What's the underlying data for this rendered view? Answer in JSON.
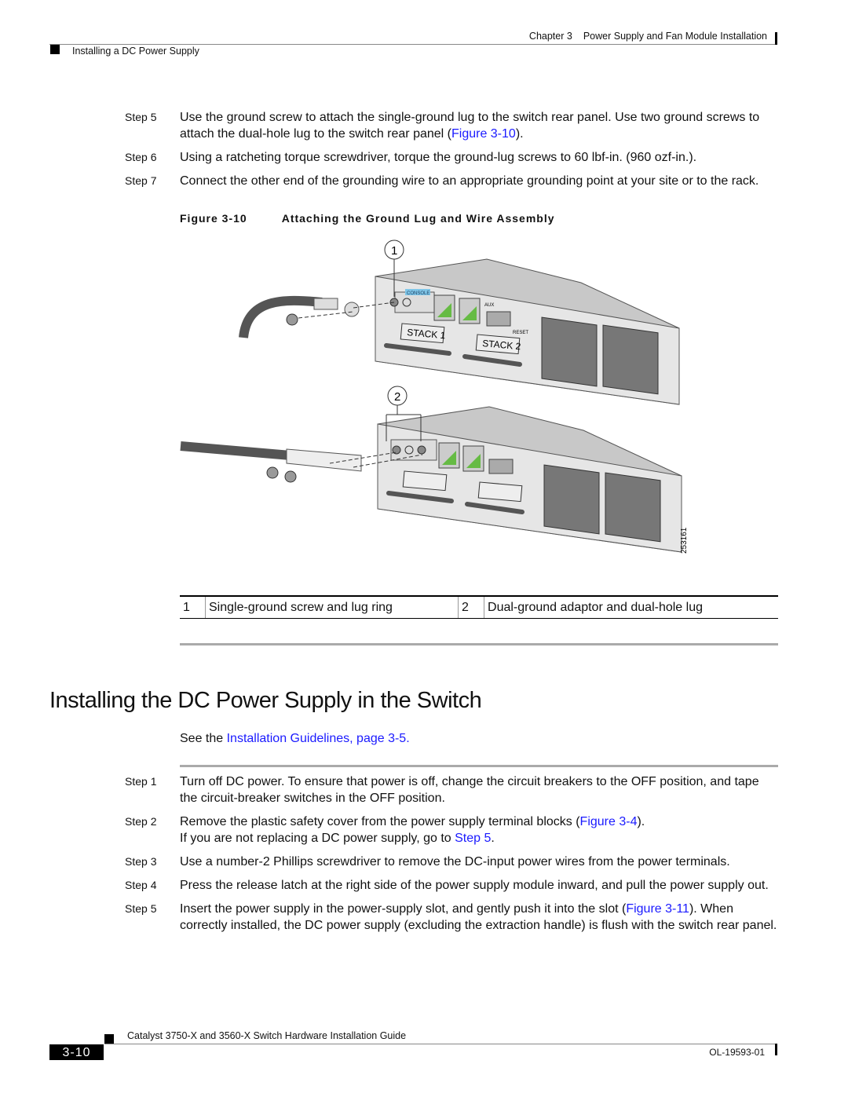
{
  "header": {
    "chapter": "Chapter 3",
    "chapter_title": "Power Supply and Fan Module Installation",
    "section": "Installing a DC Power Supply"
  },
  "steps_top": [
    {
      "label": "Step 5",
      "text_a": "Use the ground screw to attach the single-ground lug to the switch rear panel. Use two ground screws to attach the dual-hole lug to the switch rear panel (",
      "link": "Figure 3-10",
      "text_b": ")."
    },
    {
      "label": "Step 6",
      "text": "Using a ratcheting torque screwdriver, torque the ground-lug screws to 60 lbf-in. (960 ozf-in.)."
    },
    {
      "label": "Step 7",
      "text": "Connect the other end of the grounding wire to an appropriate grounding point at your site or to the rack."
    }
  ],
  "figure": {
    "number": "Figure 3-10",
    "title": "Attaching the Ground Lug and Wire Assembly",
    "callouts": [
      "1",
      "2"
    ],
    "labels": {
      "console": "CONSOLE",
      "aux": "AUX",
      "reset": "RESET",
      "stack1": "STACK 1",
      "stack2": "STACK 2"
    },
    "art_id": "253161",
    "legend": [
      {
        "num": "1",
        "text": "Single-ground screw and lug ring"
      },
      {
        "num": "2",
        "text": "Dual-ground adaptor and dual-hole lug"
      }
    ]
  },
  "section": {
    "title": "Installing the DC Power Supply in the Switch",
    "see_prefix": "See the ",
    "see_link": "Installation Guidelines, page 3-5",
    "see_suffix": "."
  },
  "steps_bottom": [
    {
      "label": "Step 1",
      "text": "Turn off DC power. To ensure that power is off, change the circuit breakers to the OFF position, and tape the circuit-breaker switches in the OFF position."
    },
    {
      "label": "Step 2",
      "text_a": "Remove the plastic safety cover from the power supply terminal blocks (",
      "link": "Figure 3-4",
      "text_b": ").",
      "note_a": "If you are not replacing a DC power supply, go to ",
      "note_link": "Step 5",
      "note_b": "."
    },
    {
      "label": "Step 3",
      "text": "Use a number-2 Phillips screwdriver to remove the DC-input power wires from the power terminals."
    },
    {
      "label": "Step 4",
      "text": "Press the release latch at the right side of the power supply module inward, and pull the power supply out."
    },
    {
      "label": "Step 5",
      "text_a": "Insert the power supply in the power-supply slot, and gently push it into the slot (",
      "link": "Figure 3-11",
      "text_b": "). When correctly installed, the DC power supply (excluding the extraction handle) is flush with the switch rear panel."
    }
  ],
  "footer": {
    "guide_title": "Catalyst 3750-X and 3560-X Switch Hardware Installation Guide",
    "page": "3-10",
    "doc_number": "OL-19593-01"
  }
}
